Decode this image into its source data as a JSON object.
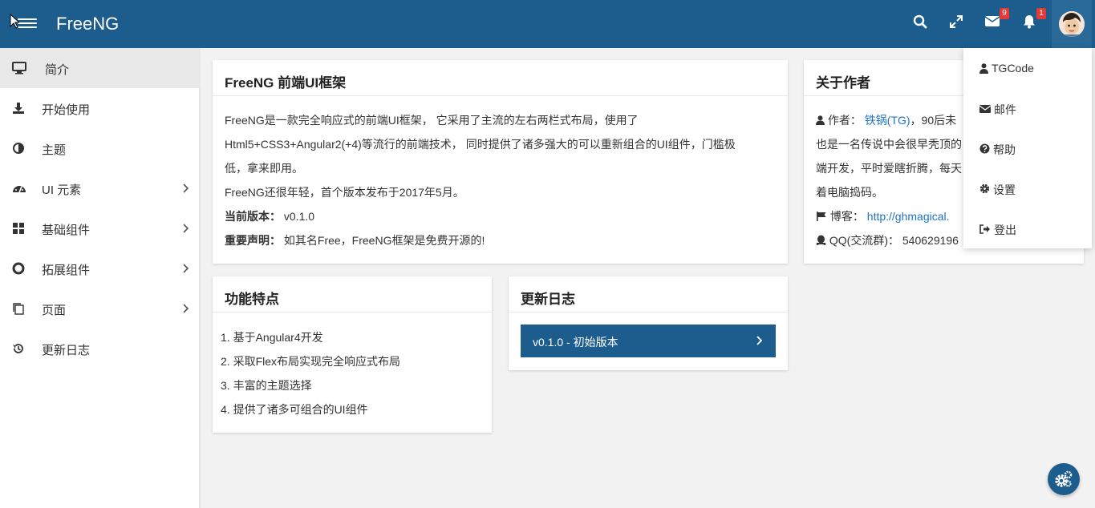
{
  "app": {
    "brand": "FreeNG"
  },
  "header": {
    "mail_count": "9",
    "notif_count": "1"
  },
  "sidebar": {
    "items": [
      {
        "label": "简介",
        "icon": "desktop-icon"
      },
      {
        "label": "开始使用",
        "icon": "download-icon"
      },
      {
        "label": "主题",
        "icon": "adjust-icon"
      },
      {
        "label": "UI 元素",
        "icon": "dashboard-icon"
      },
      {
        "label": "基础组件",
        "icon": "grid-icon"
      },
      {
        "label": "拓展组件",
        "icon": "life-ring-icon"
      },
      {
        "label": "页面",
        "icon": "pages-icon"
      },
      {
        "label": "更新日志",
        "icon": "history-icon"
      }
    ]
  },
  "intro": {
    "title": "FreeNG 前端UI框架",
    "p1": "FreeNG是一款完全响应式的前端UI框架， 它采用了主流的左右两栏式布局，使用了",
    "p2": "Html5+CSS3+Angular2(+4)等流行的前端技术， 同时提供了诸多强大的可以重新组合的UI组件，门槛极",
    "p3": "低，拿来即用。",
    "p4": "FreeNG还很年轻，首个版本发布于2017年5月。",
    "version_label": "当前版本：",
    "version_value": "v0.1.0",
    "notice_label": "重要声明：",
    "notice_value": "如其名Free，FreeNG框架是免费开源的!"
  },
  "features": {
    "title": "功能特点",
    "items": [
      "1. 基于Angular4开发",
      "2. 采取Flex布局实现完全响应式布局",
      "3. 丰富的主题选择",
      "4. 提供了诸多可组合的UI组件"
    ]
  },
  "changelog": {
    "title": "更新日志",
    "entry": "v0.1.0 - 初始版本"
  },
  "author": {
    "title": "关于作者",
    "author_label": "作者：",
    "author_name": "铁锅(TG)",
    "author_rest": "，90后未",
    "line2": "也是一名传说中会很早秃顶的",
    "line3": "端开发，平时爱瞎折腾，每天",
    "line4": "着电脑捣码。",
    "blog_label": "博客：",
    "blog_url": "http://ghmagical.",
    "qq_label": "QQ(交流群)：",
    "qq_value": "540629196"
  },
  "dropdown": {
    "items": [
      {
        "label": "TGCode",
        "icon": "user-icon"
      },
      {
        "label": "邮件",
        "icon": "envelope-icon"
      },
      {
        "label": "帮助",
        "icon": "question-circle-icon"
      },
      {
        "label": "设置",
        "icon": "cog-icon"
      },
      {
        "label": "登出",
        "icon": "sign-out-icon"
      }
    ]
  },
  "colors": {
    "primary": "#1c5d8d",
    "badge": "#e53935",
    "link": "#1c74c4"
  }
}
